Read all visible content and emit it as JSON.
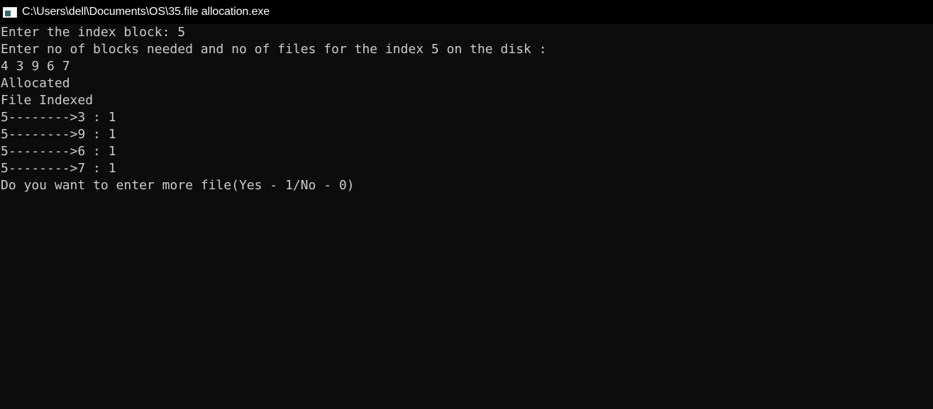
{
  "window": {
    "title": "C:\\Users\\dell\\Documents\\OS\\35.file allocation.exe"
  },
  "console": {
    "lines": [
      "Enter the index block: 5",
      "Enter no of blocks needed and no of files for the index 5 on the disk :",
      "4 3 9 6 7",
      "Allocated",
      "File Indexed",
      "5-------->3 : 1",
      "5-------->9 : 1",
      "5-------->6 : 1",
      "5-------->7 : 1",
      "Do you want to enter more file(Yes - 1/No - 0)"
    ]
  },
  "colors": {
    "background": "#0c0c0c",
    "titlebar": "#000000",
    "text": "#cccccc",
    "title_text": "#ffffff"
  },
  "icons": {
    "app_icon": "console-window-icon"
  }
}
